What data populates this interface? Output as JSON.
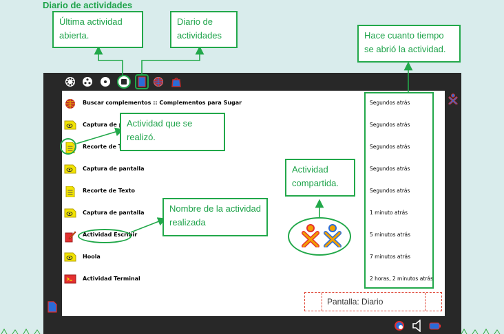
{
  "page_title": "Diario de actividades",
  "callouts": {
    "last_activity": "Última actividad abierta.",
    "journal": "Diario de actividades",
    "time_ago": "Hace cuanto tiempo se abrió la actividad.",
    "activity_done": "Actividad que se realizó.",
    "shared_activity": "Actividad compartida.",
    "activity_name": "Nombre de la actividad realizada",
    "screen_label": "Pantalla: Diario"
  },
  "toolbar": {
    "icons": [
      "neighborhood-icon",
      "group-icon",
      "home-icon",
      "activity-icon",
      "journal-icon",
      "browse-icon",
      "bag-icon"
    ]
  },
  "journal": {
    "entries": [
      {
        "title": "Buscar complementos :: Complementos para Sugar",
        "time": "Segundos atrás",
        "icon": "browse-icon"
      },
      {
        "title": "Captura de pantalla",
        "time": "Segundos atrás",
        "icon": "image-icon"
      },
      {
        "title": "Recorte de Texto",
        "time": "Segundos atrás",
        "icon": "text-icon"
      },
      {
        "title": "Captura de pantalla",
        "time": "Segundos atrás",
        "icon": "image-icon"
      },
      {
        "title": "Recorte de Texto",
        "time": "Segundos atrás",
        "icon": "text-icon"
      },
      {
        "title": "Captura de pantalla",
        "time": "1 minuto atrás",
        "icon": "image-icon"
      },
      {
        "title": "Actividad Escribir",
        "time": "5 minutos atrás",
        "icon": "write-icon"
      },
      {
        "title": "Hoola",
        "time": "7 minutos atrás",
        "icon": "image-icon"
      },
      {
        "title": "Actividad Terminal",
        "time": "2 horas, 2 minutos atrás",
        "icon": "terminal-icon"
      }
    ]
  },
  "colors": {
    "accent_green": "#22a84a",
    "frame_dark": "#282828",
    "background": "#d9ecec"
  }
}
